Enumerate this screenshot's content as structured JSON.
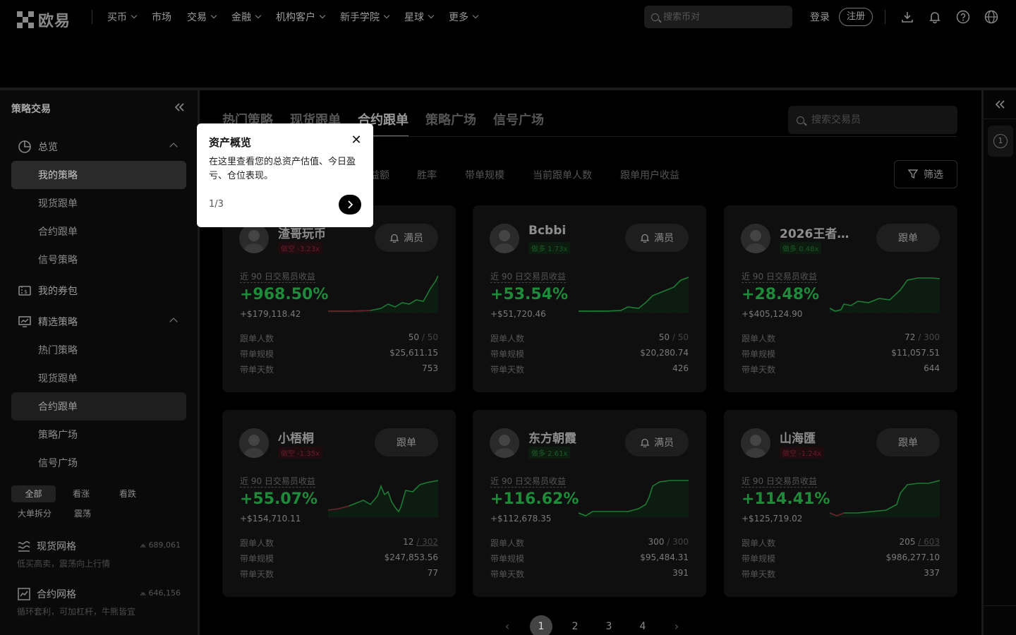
{
  "brand": {
    "name": "欧易"
  },
  "nav": {
    "items": [
      {
        "label": "买币",
        "dropdown": true
      },
      {
        "label": "市场",
        "dropdown": false
      },
      {
        "label": "交易",
        "dropdown": true
      },
      {
        "label": "金融",
        "dropdown": true
      },
      {
        "label": "机构客户",
        "dropdown": true
      },
      {
        "label": "新手学院",
        "dropdown": true
      },
      {
        "label": "星球",
        "dropdown": true
      },
      {
        "label": "更多",
        "dropdown": true
      }
    ],
    "search_placeholder": "搜索币对",
    "login": "登录",
    "register": "注册",
    "icons": [
      "download-icon",
      "bell-icon",
      "help-icon",
      "globe-icon"
    ]
  },
  "sidebar": {
    "title": "策略交易",
    "groups": {
      "overview": "总览",
      "coupons": "我的券包",
      "curated": "精选策略"
    },
    "overview_items": [
      "我的策略",
      "现货跟单",
      "合约跟单",
      "信号策略"
    ],
    "curated_items": [
      "热门策略",
      "现货跟单",
      "合约跟单",
      "策略广场",
      "信号广场"
    ],
    "chips": [
      "全部",
      "看涨",
      "看跌",
      "大单拆分",
      "震荡"
    ],
    "grids": [
      {
        "title": "现货网格",
        "count": "689,061",
        "desc": "低买高卖，震荡向上行情"
      },
      {
        "title": "合约网格",
        "count": "646,156",
        "desc": "循环套利，可加杠杆，牛熊皆宜"
      }
    ]
  },
  "main": {
    "tabs": [
      "热门策略",
      "现货跟单",
      "合约跟单",
      "策略广场",
      "信号广场"
    ],
    "active_tab": 2,
    "search_placeholder": "搜索交易员",
    "sort_fragment": "益额",
    "sort_items": [
      "胜率",
      "带单规模",
      "当前跟单人数",
      "跟单用户收益"
    ],
    "filter_label": "筛选"
  },
  "card_labels": {
    "earnings": "近 90 日交易员收益",
    "followers": "跟单人数",
    "aum": "带单规模",
    "days": "带单天数"
  },
  "cards": [
    {
      "name": "渣哥玩币",
      "tag": "做空 -3.23x",
      "side": "short",
      "button": "满员",
      "full": true,
      "pct": "+968.50%",
      "amount": "+$179,118.42",
      "followers": "50",
      "cap": "/ 50",
      "cap_ul": false,
      "aum": "$25,611.15",
      "days": "753"
    },
    {
      "name": "Bcbbi",
      "tag": "做多 1.73x",
      "side": "long",
      "button": "满员",
      "full": true,
      "pct": "+53.54%",
      "amount": "+$51,720.46",
      "followers": "50",
      "cap": "/ 50",
      "cap_ul": false,
      "aum": "$20,280.74",
      "days": "426"
    },
    {
      "name": "2026王者...",
      "tag": "做多 0.48x",
      "side": "long",
      "button": "跟单",
      "full": false,
      "pct": "+28.48%",
      "amount": "+$405,124.90",
      "followers": "72",
      "cap": "/ 300",
      "cap_ul": false,
      "aum": "$11,057.51",
      "days": "644"
    },
    {
      "name": "小梧桐",
      "tag": "做空 -1.35x",
      "side": "short",
      "button": "跟单",
      "full": false,
      "pct": "+55.07%",
      "amount": "+$154,710.11",
      "followers": "12",
      "cap": "/ 302",
      "cap_ul": true,
      "aum": "$247,853.56",
      "days": "77"
    },
    {
      "name": "东方朝霞",
      "tag": "做多 2.61x",
      "side": "long",
      "button": "满员",
      "full": true,
      "pct": "+116.62%",
      "amount": "+$112,678.35",
      "followers": "300",
      "cap": "/ 300",
      "cap_ul": false,
      "aum": "$95,484.31",
      "days": "391"
    },
    {
      "name": "山海匯",
      "tag": "做空 -1.24x",
      "side": "short",
      "button": "跟单",
      "full": false,
      "pct": "+114.41%",
      "amount": "+$125,719.02",
      "followers": "205",
      "cap": "/ 603",
      "cap_ul": true,
      "aum": "$986,277.10",
      "days": "337"
    }
  ],
  "pagination": {
    "pages": [
      "1",
      "2",
      "3",
      "4"
    ],
    "current": "1"
  },
  "rail": {
    "badge": "1"
  },
  "popover": {
    "title": "资产概览",
    "body": "在这里查看您的总资产估值、今日盈亏、仓位表现。",
    "step": "1/3"
  }
}
